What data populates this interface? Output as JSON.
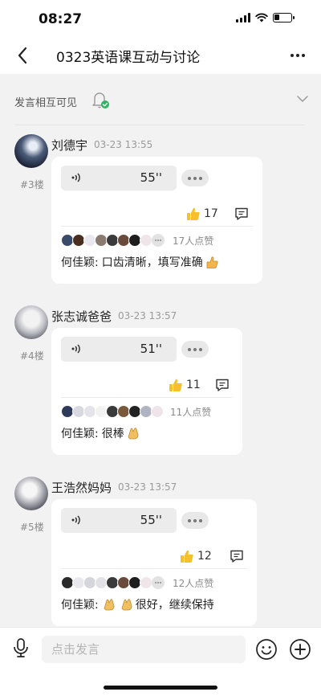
{
  "status_bar": {
    "time": "08:27",
    "battery_level": 0.3
  },
  "nav": {
    "title": "0323英语课互动与讨论",
    "back_icon": "chevron-left-icon",
    "more_icon": "more-horizontal-icon"
  },
  "visibility": {
    "label": "发言相互可见",
    "bell_icon": "bell-check-icon",
    "expand_icon": "chevron-down-icon"
  },
  "posts": [
    {
      "author": "刘德宇",
      "time": "03-23 13:55",
      "floor": "#3楼",
      "voice_duration": "55''",
      "likes": "17",
      "like_summary": "17人点赞",
      "comment_author": "何佳颖:",
      "comment_text": "口齿清晰，填写准确",
      "comment_emojis": [
        "thumbs-up-emoji"
      ]
    },
    {
      "author": "张志诚爸爸",
      "time": "03-23 13:57",
      "floor": "#4楼",
      "voice_duration": "51''",
      "likes": "11",
      "like_summary": "11人点赞",
      "comment_author": "何佳颖:",
      "comment_text": "很棒",
      "comment_emojis": [
        "clapping-emoji"
      ]
    },
    {
      "author": "王浩然妈妈",
      "time": "03-23 13:57",
      "floor": "#5楼",
      "voice_duration": "55''",
      "likes": "12",
      "like_summary": "12人点赞",
      "comment_author": "何佳颖:",
      "comment_text": "很好，继续保持",
      "comment_emojis": [
        "clapping-emoji",
        "clapping-emoji"
      ]
    }
  ],
  "input_bar": {
    "placeholder": "点击发言",
    "mic_icon": "microphone-icon",
    "emoji_icon": "smiley-icon",
    "add_icon": "plus-circle-icon"
  },
  "colors": {
    "accent": "#2fb463",
    "thumb": "#f5c02c",
    "bg": "#f2f2f2"
  }
}
